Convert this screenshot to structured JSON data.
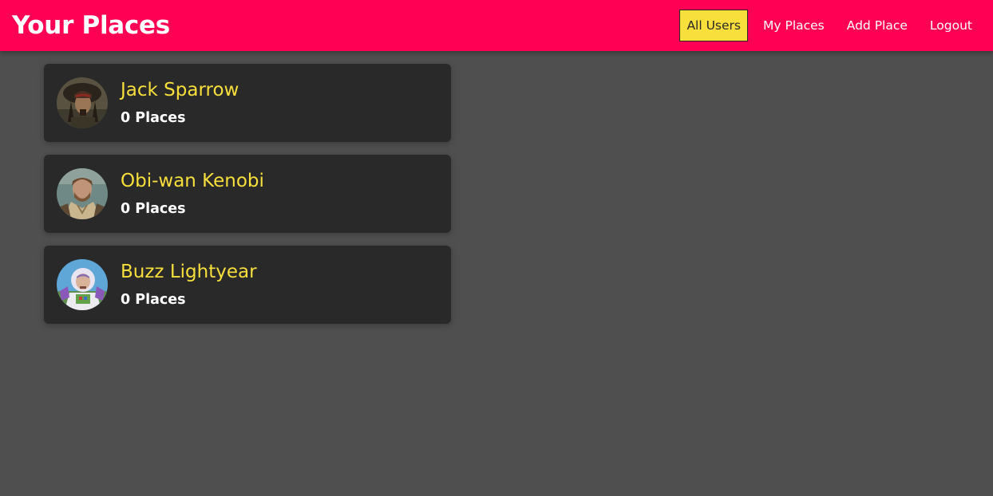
{
  "header": {
    "title": "Your Places",
    "brand_color": "#ff0055",
    "nav": [
      {
        "label": "All Users",
        "active": true
      },
      {
        "label": "My Places",
        "active": false
      },
      {
        "label": "Add Place",
        "active": false
      },
      {
        "label": "Logout",
        "active": false
      }
    ]
  },
  "users": [
    {
      "name": "Jack Sparrow",
      "places": "0 Places",
      "avatar": "jack-sparrow-avatar"
    },
    {
      "name": "Obi-wan Kenobi",
      "places": "0 Places",
      "avatar": "obi-wan-kenobi-avatar"
    },
    {
      "name": "Buzz Lightyear",
      "places": "0 Places",
      "avatar": "buzz-lightyear-avatar"
    }
  ],
  "colors": {
    "background": "#4f4f4f",
    "card": "#292929",
    "accent": "#f8df3b",
    "text": "#ffffff"
  }
}
